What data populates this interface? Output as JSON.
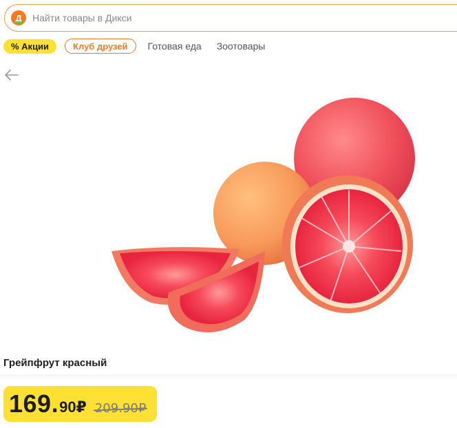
{
  "search": {
    "logo_letter": "Д",
    "placeholder": "Найти товары в Дикси"
  },
  "nav": {
    "promo_label": "% Акции",
    "club_label": "Клуб друзей",
    "categories": [
      "Готовая еда",
      "Зоотовары"
    ]
  },
  "product": {
    "name": "Грейпфрут красный",
    "price_int": "169.",
    "price_dec": "90₽",
    "old_price": "209.90₽"
  },
  "colors": {
    "brand_orange": "#f47b1f",
    "promo_yellow": "#ffe033",
    "logo_green": "#5ec45c"
  },
  "icons": {
    "back": "arrow-left-icon",
    "logo": "dixy-logo-icon"
  }
}
